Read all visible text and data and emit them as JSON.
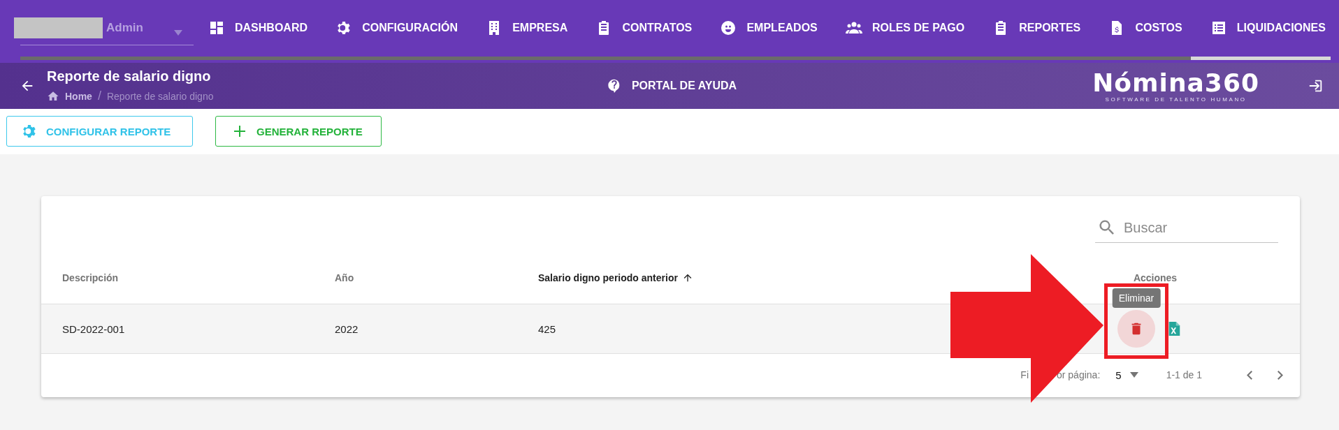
{
  "nav": {
    "user": {
      "name": "Admin"
    },
    "items": [
      {
        "label": "DASHBOARD"
      },
      {
        "label": "CONFIGURACIÓN"
      },
      {
        "label": "EMPRESA"
      },
      {
        "label": "CONTRATOS"
      },
      {
        "label": "EMPLEADOS"
      },
      {
        "label": "ROLES DE PAGO"
      },
      {
        "label": "REPORTES"
      },
      {
        "label": "COSTOS"
      },
      {
        "label": "LIQUIDACIONES"
      }
    ]
  },
  "header": {
    "title": "Reporte de salario digno",
    "breadcrumbs": [
      {
        "label": "Home",
        "kind": "link"
      },
      {
        "label": "/",
        "kind": "separator"
      },
      {
        "label": "Reporte de salario digno",
        "kind": "current"
      }
    ],
    "help_link": "PORTAL DE AYUDA",
    "logo": {
      "name": "Nómina360",
      "tagline": "SOFTWARE DE TALENTO HUMANO"
    }
  },
  "toolbar": [
    {
      "label": "CONFIGURAR REPORTE",
      "kind": "configure"
    },
    {
      "label": "GENERAR REPORTE",
      "kind": "generate"
    }
  ],
  "table": {
    "search": {
      "placeholder": "Buscar"
    },
    "columns": [
      {
        "label": "Descripción",
        "sorted": false
      },
      {
        "label": "Año",
        "sorted": false
      },
      {
        "label": "Salario digno periodo anterior",
        "sorted": true
      },
      {
        "label": "Acciones",
        "sorted": false
      }
    ],
    "rows": [
      {
        "cells": [
          "SD-2022-001",
          "2022",
          "425"
        ],
        "actions": [
          {
            "kind": "delete",
            "hovered": true,
            "tooltip": "Eliminar"
          },
          {
            "kind": "excel",
            "hovered": false
          }
        ]
      }
    ],
    "pagination": {
      "rows_label_parts": [
        "Fi",
        "or página:"
      ],
      "page_size": "5",
      "range": "1-1 de 1"
    }
  }
}
